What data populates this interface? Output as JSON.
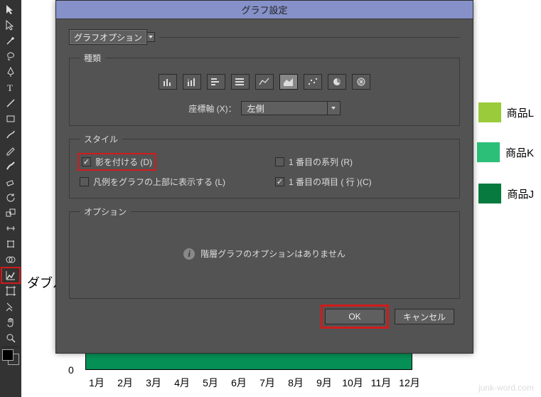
{
  "dialog": {
    "title": "グラフ設定",
    "graph_options_label": "グラフオプション",
    "type_legend": "種類",
    "axis_label": "座標軸 (X)：",
    "axis_value": "左側",
    "style_legend": "スタイル",
    "check_shadow": "影を付ける (D)",
    "check_legend_top": "凡例をグラフの上部に表示する (L)",
    "check_first_series": "1 番目の系列 (R)",
    "check_first_item": "1 番目の項目 ( 行 )(C)",
    "options_legend": "オプション",
    "options_message": "階層グラフのオプションはありません",
    "ok_label": "OK",
    "cancel_label": "キャンセル"
  },
  "chart_data": {
    "type": "bar",
    "categories": [
      "1月",
      "2月",
      "3月",
      "4月",
      "5月",
      "6月",
      "7月",
      "8月",
      "9月",
      "10月",
      "11月",
      "12月"
    ],
    "series": [
      {
        "name": "商品L"
      },
      {
        "name": "商品K"
      },
      {
        "name": "商品J"
      }
    ],
    "ylim": [
      0,
      null
    ],
    "zero_label": "0"
  },
  "legend": {
    "items": [
      {
        "label": "商品L",
        "color": "#9acb3b"
      },
      {
        "label": "商品K",
        "color": "#2bbf78"
      },
      {
        "label": "商品J",
        "color": "#067a3f"
      }
    ]
  },
  "annotations": {
    "double_click": "ダブルクリック"
  },
  "watermark": "junk-word.com"
}
